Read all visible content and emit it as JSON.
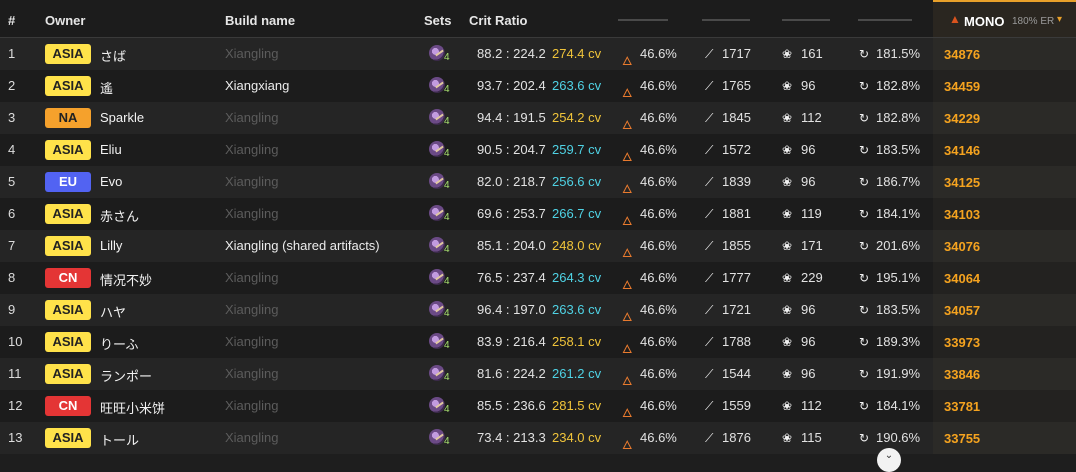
{
  "header": {
    "rank": "#",
    "owner": "Owner",
    "build": "Build name",
    "sets": "Sets",
    "crit": "Crit Ratio",
    "mono_label": "MONO",
    "mono_er": "180% ER",
    "mono_icon": "flame-icon",
    "chevron": "▾"
  },
  "icons": {
    "set": "artifact-set-icon",
    "element": "pyro-icon",
    "atk": "sword-icon",
    "em": "elemental-mastery-icon",
    "er": "energy-recharge-icon"
  },
  "colors": {
    "asia": "#ffe24a",
    "na": "#f5a12c",
    "eu": "#5263f2",
    "cn": "#e43535",
    "cv_cyan": "#4fd2e4",
    "cv_gold": "#f0c43a",
    "score": "#f5a31f"
  },
  "rows": [
    {
      "rank": "1",
      "region": "ASIA",
      "owner": "さば",
      "build": "Xiangling",
      "set": "4",
      "crit": "88.2 : 224.2",
      "cv": "274.4 cv",
      "pyro": "46.6%",
      "atk": "1717",
      "em": "161",
      "er": "181.5%",
      "score": "34876"
    },
    {
      "rank": "2",
      "region": "ASIA",
      "owner": "遙",
      "build": "Xiangxiang",
      "set": "4",
      "crit": "93.7 : 202.4",
      "cv": "263.6 cv",
      "pyro": "46.6%",
      "atk": "1765",
      "em": "96",
      "er": "182.8%",
      "score": "34459"
    },
    {
      "rank": "3",
      "region": "NA",
      "owner": "Sparkle",
      "build": "Xiangling",
      "set": "4",
      "crit": "94.4 : 191.5",
      "cv": "254.2 cv",
      "pyro": "46.6%",
      "atk": "1845",
      "em": "112",
      "er": "182.8%",
      "score": "34229"
    },
    {
      "rank": "4",
      "region": "ASIA",
      "owner": "Eliu",
      "build": "Xiangling",
      "set": "4",
      "crit": "90.5 : 204.7",
      "cv": "259.7 cv",
      "pyro": "46.6%",
      "atk": "1572",
      "em": "96",
      "er": "183.5%",
      "score": "34146"
    },
    {
      "rank": "5",
      "region": "EU",
      "owner": "Evo",
      "build": "Xiangling",
      "set": "4",
      "crit": "82.0 : 218.7",
      "cv": "256.6 cv",
      "pyro": "46.6%",
      "atk": "1839",
      "em": "96",
      "er": "186.7%",
      "score": "34125"
    },
    {
      "rank": "6",
      "region": "ASIA",
      "owner": "赤さん",
      "build": "Xiangling",
      "set": "4",
      "crit": "69.6 : 253.7",
      "cv": "266.7 cv",
      "pyro": "46.6%",
      "atk": "1881",
      "em": "119",
      "er": "184.1%",
      "score": "34103"
    },
    {
      "rank": "7",
      "region": "ASIA",
      "owner": "Lilly",
      "build": "Xiangling (shared artifacts)",
      "set": "4",
      "crit": "85.1 : 204.0",
      "cv": "248.0 cv",
      "pyro": "46.6%",
      "atk": "1855",
      "em": "171",
      "er": "201.6%",
      "score": "34076"
    },
    {
      "rank": "8",
      "region": "CN",
      "owner": "情况不妙",
      "build": "Xiangling",
      "set": "4",
      "crit": "76.5 : 237.4",
      "cv": "264.3 cv",
      "pyro": "46.6%",
      "atk": "1777",
      "em": "229",
      "er": "195.1%",
      "score": "34064"
    },
    {
      "rank": "9",
      "region": "ASIA",
      "owner": "ハヤ",
      "build": "Xiangling",
      "set": "4",
      "crit": "96.4 : 197.0",
      "cv": "263.6 cv",
      "pyro": "46.6%",
      "atk": "1721",
      "em": "96",
      "er": "183.5%",
      "score": "34057"
    },
    {
      "rank": "10",
      "region": "ASIA",
      "owner": "りーふ",
      "build": "Xiangling",
      "set": "4",
      "crit": "83.9 : 216.4",
      "cv": "258.1 cv",
      "pyro": "46.6%",
      "atk": "1788",
      "em": "96",
      "er": "189.3%",
      "score": "33973"
    },
    {
      "rank": "11",
      "region": "ASIA",
      "owner": "ランポー",
      "build": "Xiangling",
      "set": "4",
      "crit": "81.6 : 224.2",
      "cv": "261.2 cv",
      "pyro": "46.6%",
      "atk": "1544",
      "em": "96",
      "er": "191.9%",
      "score": "33846"
    },
    {
      "rank": "12",
      "region": "CN",
      "owner": "旺旺小米饼",
      "build": "Xiangling",
      "set": "4",
      "crit": "85.5 : 236.6",
      "cv": "281.5 cv",
      "pyro": "46.6%",
      "atk": "1559",
      "em": "112",
      "er": "184.1%",
      "score": "33781"
    },
    {
      "rank": "13",
      "region": "ASIA",
      "owner": "トール",
      "build": "Xiangling",
      "set": "4",
      "crit": "73.4 : 213.3",
      "cv": "234.0 cv",
      "pyro": "46.6%",
      "atk": "1876",
      "em": "115",
      "er": "190.6%",
      "score": "33755"
    }
  ],
  "lit_builds": [
    "Xiangxiang",
    "Xiangling (shared artifacts)"
  ],
  "scroll_button": "⌄"
}
